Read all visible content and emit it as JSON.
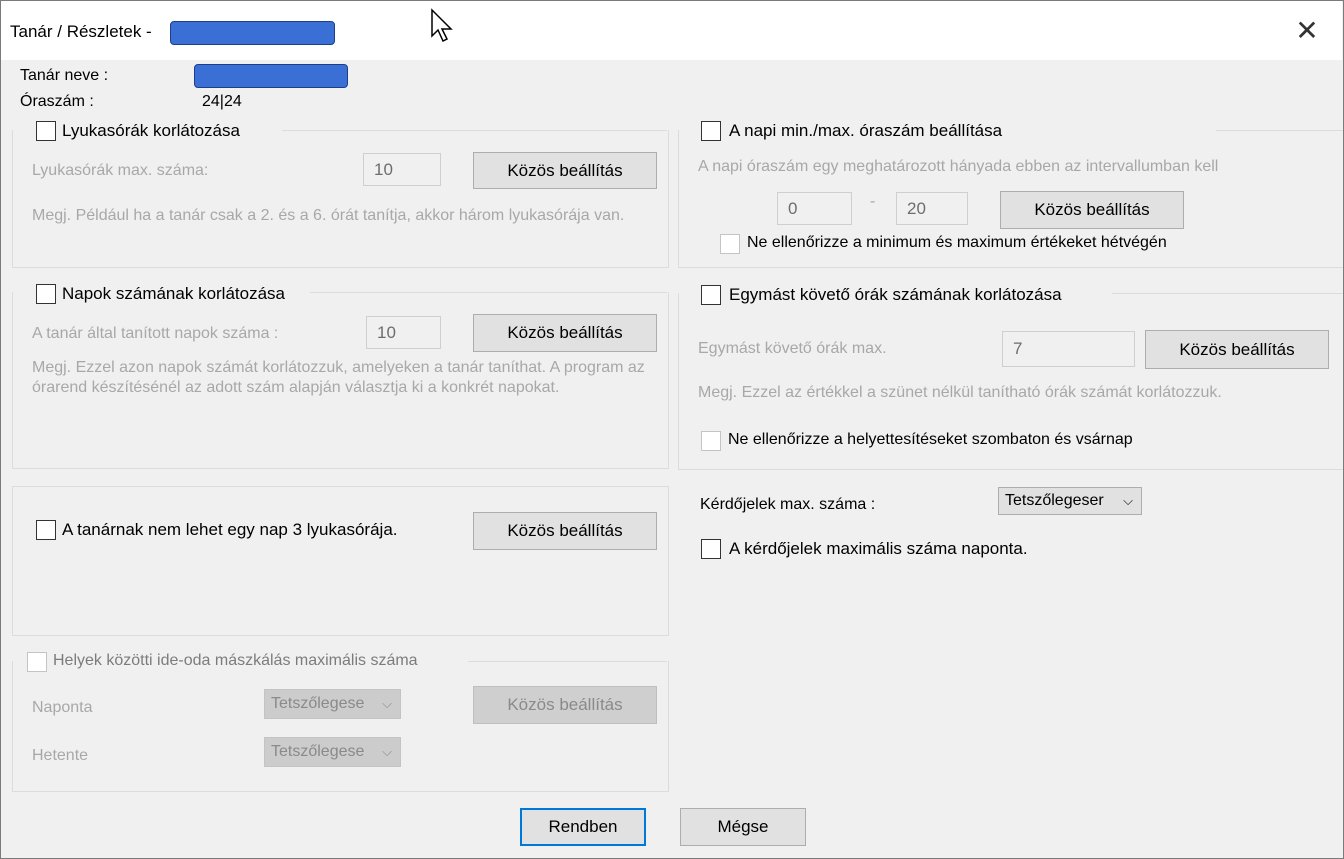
{
  "window": {
    "title": "Tanár / Részletek -",
    "close_glyph": "✕"
  },
  "teacher": {
    "name_label": "Tanár neve :",
    "hours_label": "Óraszám :",
    "hours_value": "24|24"
  },
  "gaps": {
    "checkbox_label": "Lyukasórák korlátozása",
    "max_label": "Lyukasórák max. száma:",
    "max_value": "10",
    "button": "Közös beállítás",
    "note": "Megj. Például ha a tanár csak a 2. és a 6. órát tanítja, akkor három lyukasórája van."
  },
  "daily_minmax": {
    "checkbox_label": "A napi min./max. óraszám beállítása",
    "description": "A napi óraszám egy meghatározott hányada ebben az intervallumban kell",
    "min_value": "0",
    "dash": "-",
    "max_value": "20",
    "button": "Közös beállítás",
    "weekend_label": "Ne ellenőrizze a minimum és maximum értékeket hétvégén"
  },
  "days_limit": {
    "checkbox_label": "Napok számának korlátozása",
    "days_label": "A tanár által tanított napok száma :",
    "days_value": "10",
    "button": "Közös beállítás",
    "note": "Megj. Ezzel azon napok számát korlátozzuk, amelyeken a tanár taníthat. A program az órarend készítésénél az adott szám alapján választja ki a konkrét napokat."
  },
  "consecutive": {
    "checkbox_label": "Egymást követő órák számának korlátozása",
    "max_label": "Egymást követő órák max.",
    "max_value": "7",
    "button": "Közös beállítás",
    "note": "Megj. Ezzel az értékkel a szünet nélkül tanítható órák számát korlátozzuk.",
    "weekend_label": "Ne ellenőrizze a helyettesítéseket szombaton és vsárnap"
  },
  "three_gaps": {
    "checkbox_label": "A tanárnak nem lehet egy nap 3 lyukasórája.",
    "button": "Közös beállítás"
  },
  "question_marks": {
    "max_label": "Kérdőjelek max. száma :",
    "select_value": "Tetszőlegeser",
    "checkbox_label": "A kérdőjelek maximális száma naponta."
  },
  "room_moves": {
    "checkbox_label": "Helyek közötti ide-oda mászkálás maximális száma",
    "daily_label": "Naponta",
    "daily_value": "Tetszőlegese",
    "weekly_label": "Hetente",
    "weekly_value": "Tetszőlegese",
    "button": "Közös beállítás"
  },
  "footer": {
    "ok": "Rendben",
    "cancel": "Mégse"
  },
  "colors": {
    "redaction": "#3a6fd6",
    "accent": "#0078d7"
  },
  "icons": {
    "chevron": "⌵",
    "cursor": "arrow-cursor-icon"
  }
}
